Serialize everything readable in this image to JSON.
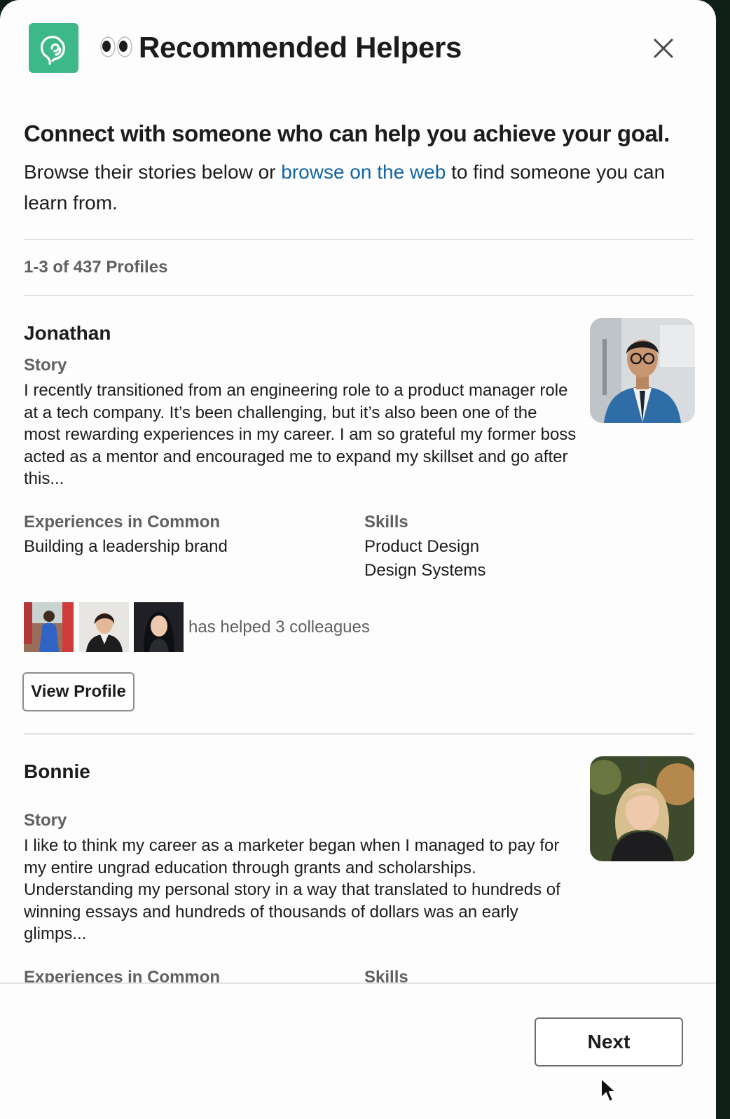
{
  "modal": {
    "title": "Recommended Helpers",
    "icons": {
      "app": "helper-app-icon",
      "eyes": "eyes-emoji-icon",
      "close": "close-icon"
    }
  },
  "intro": {
    "headline": "Connect with someone who can help you achieve your goal.",
    "text_before_link": "Browse their stories below or ",
    "link_text": "browse on the web",
    "text_after_link": " to find someone you can learn from."
  },
  "results": {
    "count_label": "1-3 of 437 Profiles"
  },
  "profiles": [
    {
      "name": "Jonathan",
      "story_label": "Story",
      "story": "I recently transitioned from an engineering role to a product manager role at a tech company. It’s been challenging, but it’s also been one of the most rewarding experiences in my career. I am so grateful my former boss acted as a mentor and encouraged me to expand my skillset and go after this...",
      "experiences_label": "Experiences in Common",
      "experiences": [
        "Building a leadership brand"
      ],
      "skills_label": "Skills",
      "skills": [
        "Product Design",
        "Design Systems"
      ],
      "helped_text": "has helped 3 colleagues",
      "view_button": "View Profile"
    },
    {
      "name": "Bonnie",
      "story_label": "Story",
      "story": "I like to think my career as a marketer began when I managed to pay for my entire ungrad education through grants and scholarships. Understanding my personal story in a way that translated to hundreds of winning essays and hundreds of thousands of dollars was an early glimps...",
      "experiences_label": "Experiences in Common",
      "skills_label": "Skills"
    }
  ],
  "footer": {
    "next_label": "Next"
  },
  "colors": {
    "link": "#1264a3",
    "app_icon": "#3db889",
    "muted_text": "#616061"
  }
}
